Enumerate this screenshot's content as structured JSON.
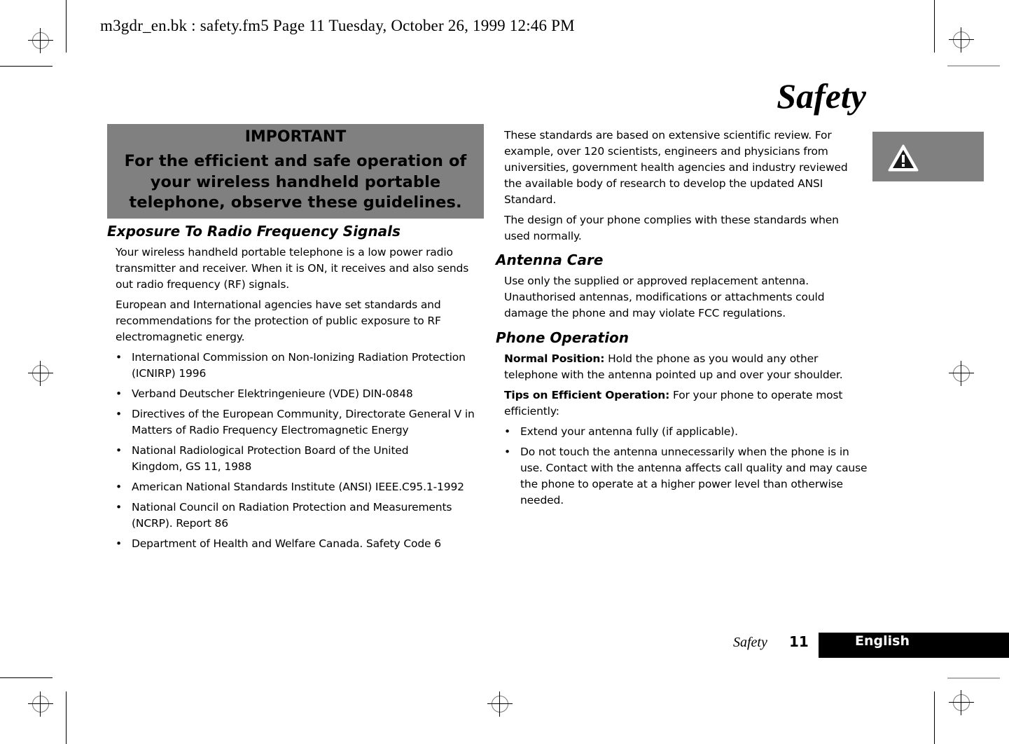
{
  "header": {
    "slug": "m3gdr_en.bk : safety.fm5  Page 11  Tuesday, October 26, 1999  12:46 PM"
  },
  "page_title": "Safety",
  "important_box": {
    "title": "IMPORTANT",
    "text": "For the efficient and safe operation of your wireless handheld portable telephone, observe these guidelines."
  },
  "warning_icon": "warning-triangle-icon",
  "left_column": {
    "section_heading": "Exposure To Radio Frequency Signals",
    "paragraphs": [
      "Your wireless handheld portable telephone is a low power radio transmitter and receiver. When it is ON, it receives and also sends out radio frequency (RF) signals.",
      "European and International agencies have set standards and recommendations for the protection of public exposure to RF electromagnetic energy."
    ],
    "bullet_symbol": "•",
    "bullets": [
      "International Commission on Non-Ionizing Radiation Protection (ICNIRP) 1996",
      "Verband Deutscher Elektringenieure (VDE) DIN-0848",
      "Directives of the European Community, Directorate General V in Matters of Radio Frequency Electromagnetic Energy",
      "National Radiological Protection Board of the United Kingdom, GS 11, 1988",
      "American National Standards Institute (ANSI) IEEE.C95.1-1992",
      "National Council on Radiation Protection and Measurements (NCRP). Report 86",
      "Department of Health and Welfare Canada. Safety Code 6"
    ]
  },
  "right_column": {
    "paragraphs": [
      "These standards are based on extensive scientific review. For example, over 120 scientists, engineers and physicians from universities, government health agencies and industry reviewed the available body of research to develop the updated ANSI Standard.",
      "The design of your phone complies with these standards when used normally."
    ],
    "antenna_care": {
      "heading": "Antenna Care",
      "text": "Use only the supplied or approved replacement antenna. Unauthorised antennas, modifications or attachments could damage the phone and may violate FCC regulations."
    },
    "phone_operation": {
      "heading": "Phone Operation",
      "normal_position": {
        "label": "Normal Position:",
        "text": " Hold the phone as you would any other telephone with the antenna pointed up and over your shoulder."
      },
      "tips": {
        "label": "Tips on Efficient Operation:",
        "text": " For your phone to operate most efficiently:"
      },
      "bullets": [
        "Extend your antenna fully (if applicable).",
        "Do not touch the antenna unnecessarily when the phone is in use. Contact with the antenna affects call quality and may cause the phone to operate at a higher power level than otherwise needed."
      ]
    }
  },
  "footer": {
    "section": "Safety",
    "page_number": "11",
    "language_tab": "English"
  }
}
